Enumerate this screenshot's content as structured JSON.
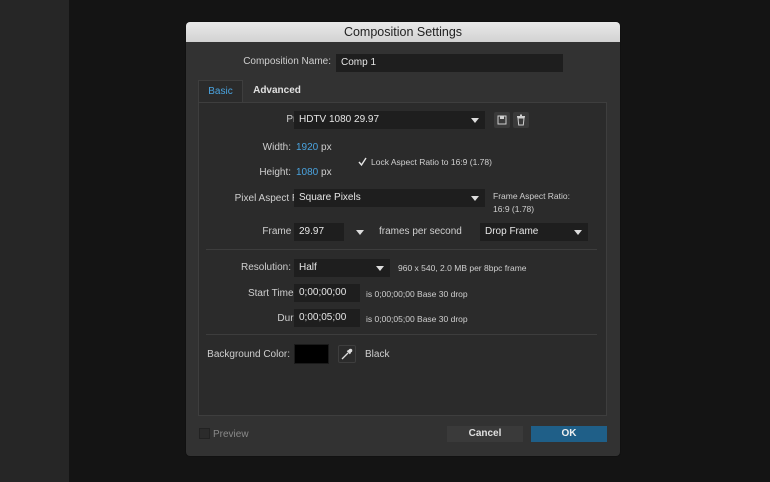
{
  "dialog": {
    "title": "Composition Settings",
    "comp_name_label": "Composition Name:",
    "comp_name_value": "Comp 1"
  },
  "tabs": [
    {
      "label": "Basic",
      "active": true
    },
    {
      "label": "Advanced",
      "active": false
    }
  ],
  "basic": {
    "preset_label": "Preset:",
    "preset_value": "HDTV 1080 29.97",
    "width_label": "Width:",
    "width_value": "1920",
    "width_unit": "px",
    "height_label": "Height:",
    "height_value": "1080",
    "height_unit": "px",
    "lock_aspect_label": "Lock Aspect Ratio to 16:9 (1.78)",
    "lock_aspect_checked": true,
    "pixel_aspect_label": "Pixel Aspect Ratio:",
    "pixel_aspect_value": "Square Pixels",
    "frame_aspect_label": "Frame Aspect Ratio:",
    "frame_aspect_value": "16:9 (1.78)",
    "frame_rate_label": "Frame Rate:",
    "frame_rate_value": "29.97",
    "frames_per_second_label": "frames per second",
    "drop_frame_value": "Drop Frame",
    "resolution_label": "Resolution:",
    "resolution_value": "Half",
    "resolution_info": "960 x 540, 2.0 MB per 8bpc frame",
    "start_timecode_label": "Start Timecode:",
    "start_timecode_value": "0;00;00;00",
    "start_timecode_info": "is 0;00;00;00  Base 30  drop",
    "duration_label": "Duration:",
    "duration_value": "0;00;05;00",
    "duration_info": "is 0;00;05;00  Base 30  drop",
    "bg_color_label": "Background Color:",
    "bg_color_name": "Black",
    "bg_color_hex": "#000000"
  },
  "footer": {
    "preview_label": "Preview",
    "cancel_label": "Cancel",
    "ok_label": "OK"
  },
  "colors": {
    "accent": "#4aa3df",
    "ok_button": "#1f5f88",
    "cancel_button": "#3a3a3a"
  },
  "icons": {
    "preset_save": "save-preset-icon",
    "preset_delete": "trash-icon",
    "eyedropper": "eyedropper-icon",
    "checkmark": "checkmark-icon"
  }
}
